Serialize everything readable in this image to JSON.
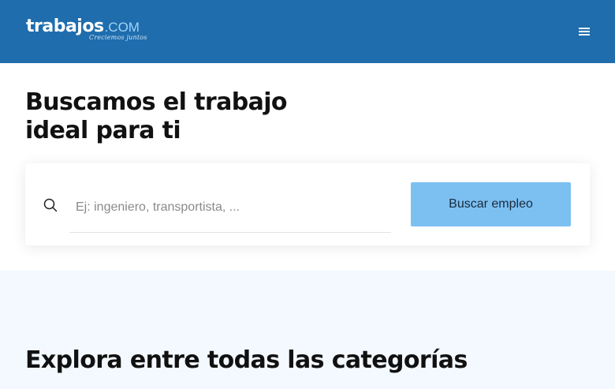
{
  "header": {
    "logo_word": "trabajos",
    "logo_suffix": ".COM",
    "logo_tagline": "Creciemos juntos",
    "menu_icon": "hamburger-menu-icon",
    "background": "#1f6dad"
  },
  "hero": {
    "title": "Buscamos el trabajo ideal para ti"
  },
  "search": {
    "icon": "search-icon",
    "placeholder": "Ej: ingeniero, transportista, ...",
    "button_label": "Buscar empleo",
    "button_color": "#7cc0f2"
  },
  "categories": {
    "title": "Explora entre todas las categorías",
    "background": "#f3f9fe"
  }
}
